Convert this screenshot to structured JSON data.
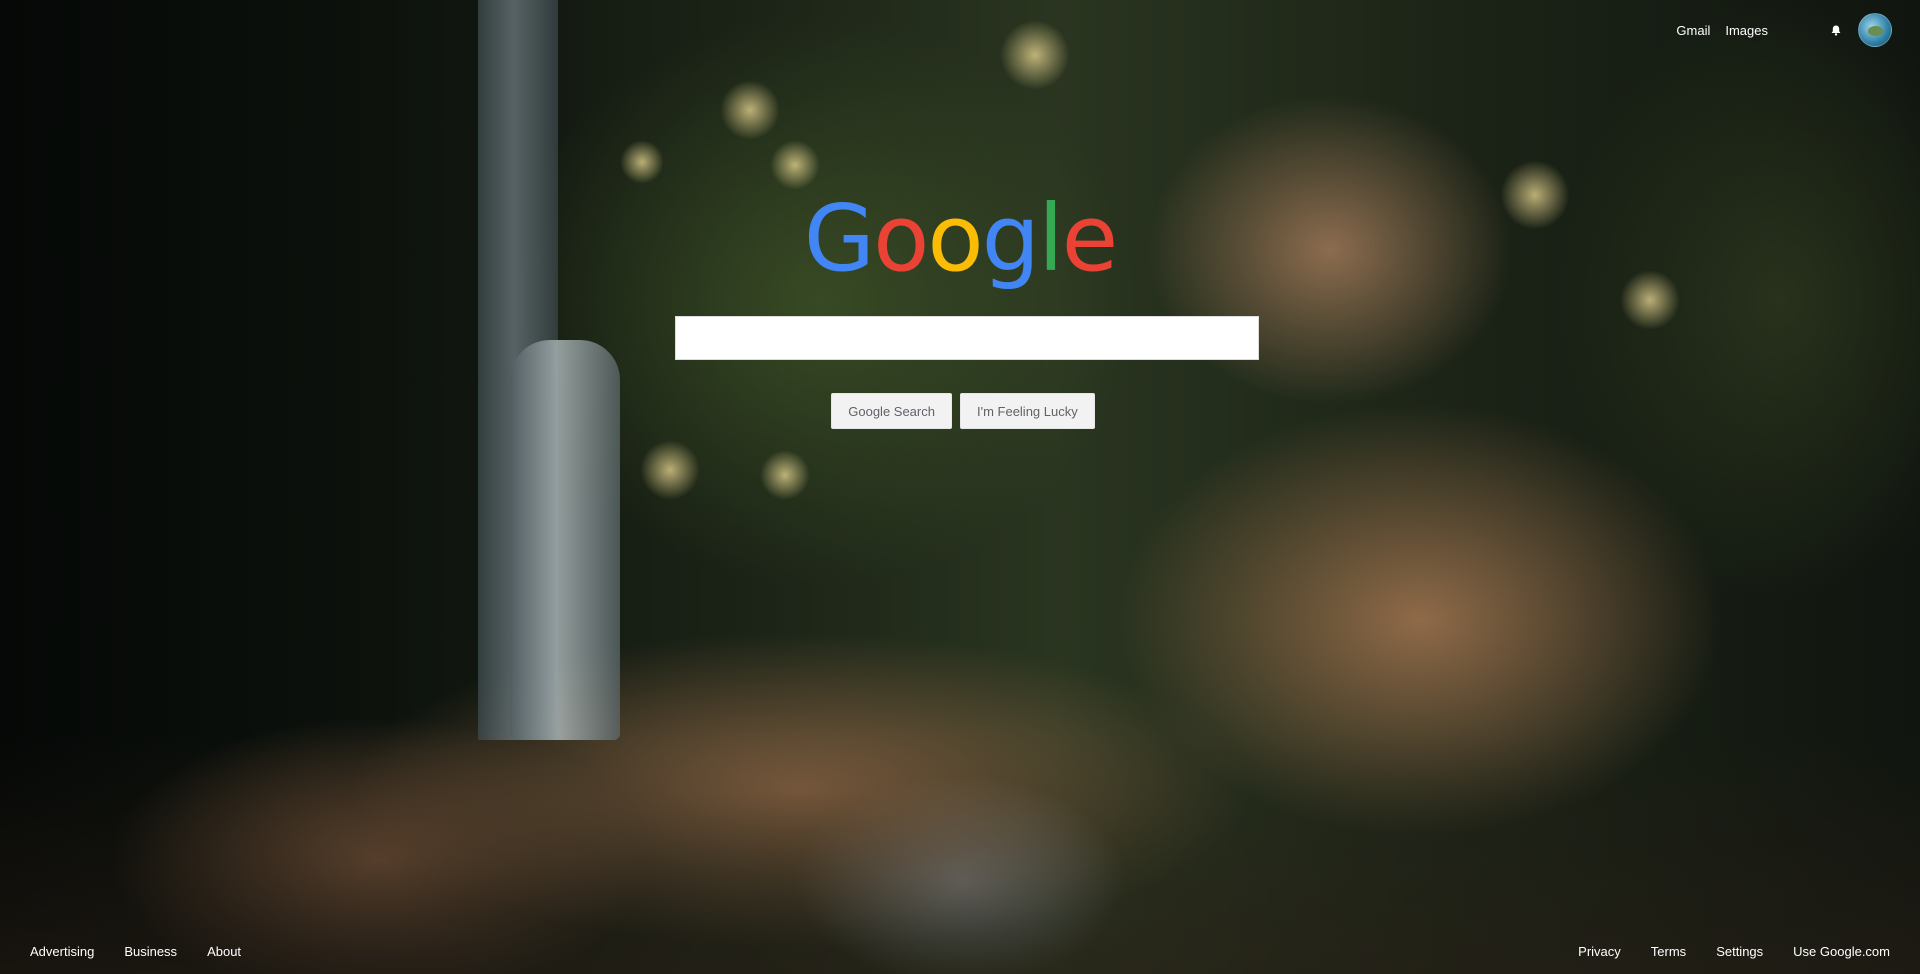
{
  "header": {
    "links": [
      "Gmail",
      "Images"
    ]
  },
  "logo": {
    "letters": [
      {
        "char": "G",
        "color": "#4285F4"
      },
      {
        "char": "o",
        "color": "#EA4335"
      },
      {
        "char": "o",
        "color": "#FBBC05"
      },
      {
        "char": "g",
        "color": "#4285F4"
      },
      {
        "char": "l",
        "color": "#34A853"
      },
      {
        "char": "e",
        "color": "#EA4335"
      }
    ]
  },
  "search": {
    "value": "",
    "placeholder": ""
  },
  "buttons": {
    "search": "Google Search",
    "lucky": "I'm Feeling Lucky"
  },
  "footer": {
    "left": [
      "Advertising",
      "Business",
      "About"
    ],
    "right": [
      "Privacy",
      "Terms",
      "Settings",
      "Use Google.com"
    ]
  },
  "icons": {
    "notifications": "bell-icon",
    "account": "avatar"
  }
}
